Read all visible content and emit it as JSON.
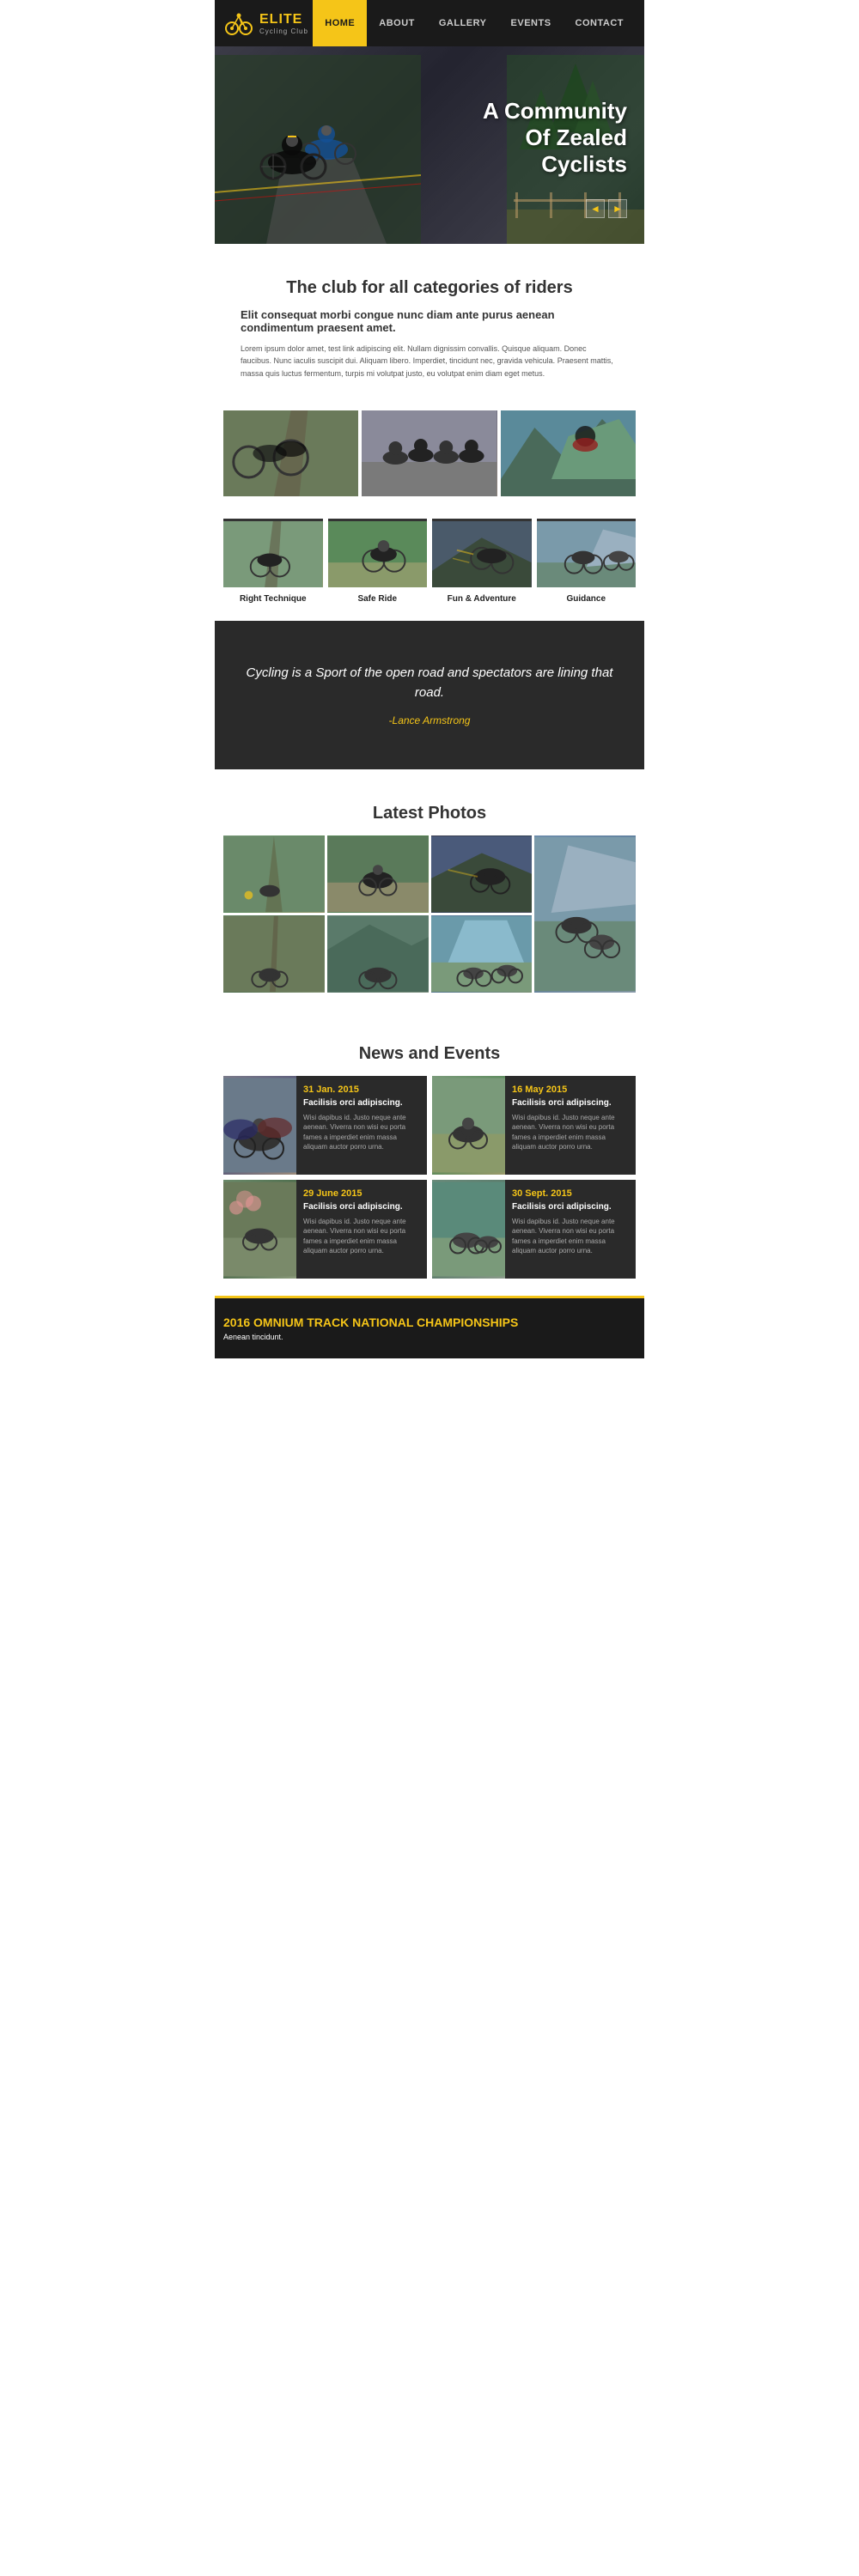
{
  "nav": {
    "logo_title": "ELITE",
    "logo_sub": "Cycling Club",
    "links": [
      {
        "label": "HOME",
        "active": true
      },
      {
        "label": "ABOUT",
        "active": false
      },
      {
        "label": "GALLERY",
        "active": false
      },
      {
        "label": "EVENTS",
        "active": false
      },
      {
        "label": "CONTACT",
        "active": false
      }
    ]
  },
  "hero": {
    "headline_line1": "A Community",
    "headline_line2": "Of Zealed",
    "headline_line3": "Cyclists",
    "arrow_left": "◄",
    "arrow_right": "►"
  },
  "club_section": {
    "heading": "The club for all categories of riders",
    "subtitle": "Elit consequat morbi congue nunc diam ante purus aenean condimentum praesent amet.",
    "body": "Lorem ipsum dolor amet, test link adipiscing elit. Nullam dignissim convallis. Quisque aliquam. Donec faucibus. Nunc iaculis suscipit dui. Aliquam libero. Imperdiet, tincidunt nec, gravida vehicula. Praesent mattis, massa quis luctus fermentum, turpis mi volutpat justo, eu volutpat enim diam eget metus."
  },
  "techniques": [
    {
      "label": "Right Technique"
    },
    {
      "label": "Safe Ride"
    },
    {
      "label": "Fun & Adventure"
    },
    {
      "label": "Guidance"
    }
  ],
  "quote": {
    "text": "Cycling is a Sport of the open road and spectators are lining that road.",
    "author": "-Lance Armstrong"
  },
  "latest_photos": {
    "heading": "Latest Photos"
  },
  "news": {
    "heading": "News and Events",
    "items": [
      {
        "date": "31 Jan. 2015",
        "title": "Facilisis orci adipiscing.",
        "body": "Wisi dapibus id. Justo neque ante aenean. Viverra non wisi eu porta fames a imperdiet enim massa aliquam auctor porro urna."
      },
      {
        "date": "16 May 2015",
        "title": "Facilisis orci adipiscing.",
        "body": "Wisi dapibus id. Justo neque ante aenean. Viverra non wisi eu porta fames a imperdiet enim massa aliquam auctor porro urna."
      },
      {
        "date": "29 June 2015",
        "title": "Facilisis orci adipiscing.",
        "body": "Wisi dapibus id. Justo neque ante aenean. Viverra non wisi eu porta fames a imperdiet enim massa aliquam auctor porro urna."
      },
      {
        "date": "30 Sept. 2015",
        "title": "Facilisis orci adipiscing.",
        "body": "Wisi dapibus id. Justo neque ante aenean. Viverra non wisi eu porta fames a imperdiet enim massa aliquam auctor porro urna."
      }
    ]
  },
  "footer_banner": {
    "heading": "2016 OMNIUM TRACK NATIONAL CHAMPIONSHIPS",
    "subtext": "Aenean tincidunt."
  }
}
